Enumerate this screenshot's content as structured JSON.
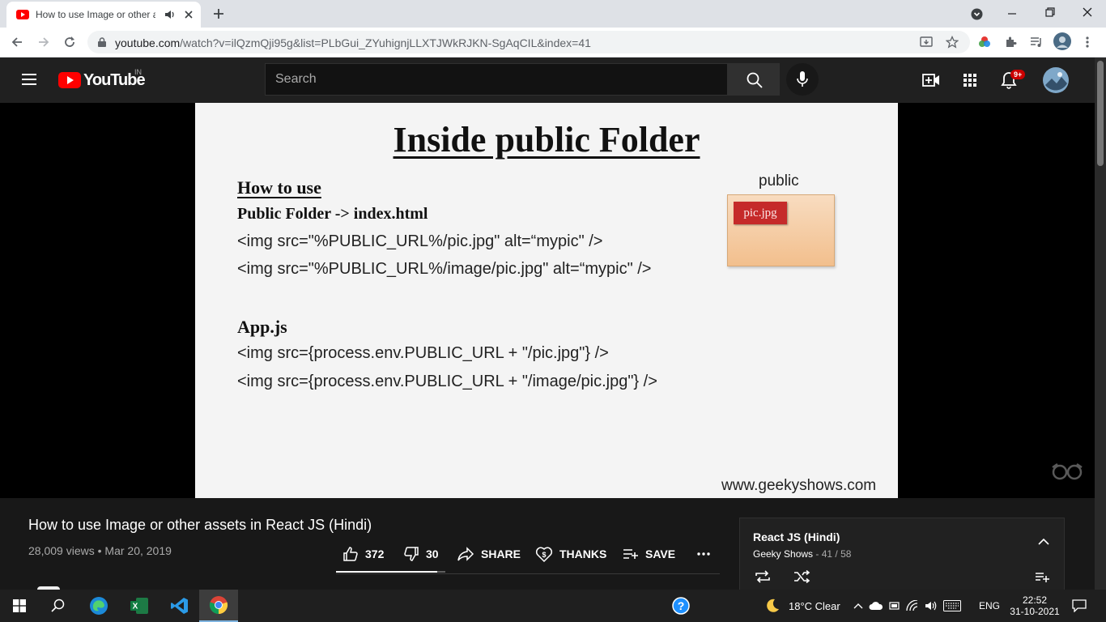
{
  "browser": {
    "tab_title": "How to use Image or other assets in React JS (Hindi)",
    "url_host": "youtube.com",
    "url_path": "/watch?v=ilQzmQji95g&list=PLbGui_ZYuhignjLLXTJWkRJKN-SgAqCIL&index=41"
  },
  "youtube": {
    "logo_text": "YouTube",
    "region": "IN",
    "search_placeholder": "Search",
    "notification_count": "9+"
  },
  "slide": {
    "heading": "Inside public Folder",
    "section1_title": "How to use",
    "section1_sub": "Public Folder -> index.html",
    "line1": "<img src=\"%PUBLIC_URL%/pic.jpg\" alt=“mypic\" />",
    "line2": "<img src=\"%PUBLIC_URL%/image/pic.jpg\" alt=“mypic\" />",
    "section2_title": "App.js",
    "line3": "<img src={process.env.PUBLIC_URL + \"/pic.jpg\"}  />",
    "line4": "<img src={process.env.PUBLIC_URL + \"/image/pic.jpg\"} />",
    "folder_label": "public",
    "file_label": "pic.jpg",
    "watermark": "www.geekyshows.com"
  },
  "video": {
    "title": "How to use Image or other assets in React JS (Hindi)",
    "views": "28,009 views",
    "date": "Mar 20, 2019",
    "likes": "372",
    "dislikes": "30",
    "share_label": "SHARE",
    "thanks_label": "THANKS",
    "save_label": "SAVE",
    "like_ratio": 0.925
  },
  "playlist": {
    "title": "React JS (Hindi)",
    "channel": "Geeky Shows",
    "position": "41 / 58"
  },
  "taskbar": {
    "weather": "18°C  Clear",
    "language": "ENG",
    "time": "22:52",
    "date": "31-10-2021"
  },
  "colors": {
    "youtube_red": "#ff0000",
    "dark_bg": "#181818",
    "header_bg": "#202020",
    "folder_fill": "#f2bf8d",
    "file_fill": "#c52a2a"
  }
}
